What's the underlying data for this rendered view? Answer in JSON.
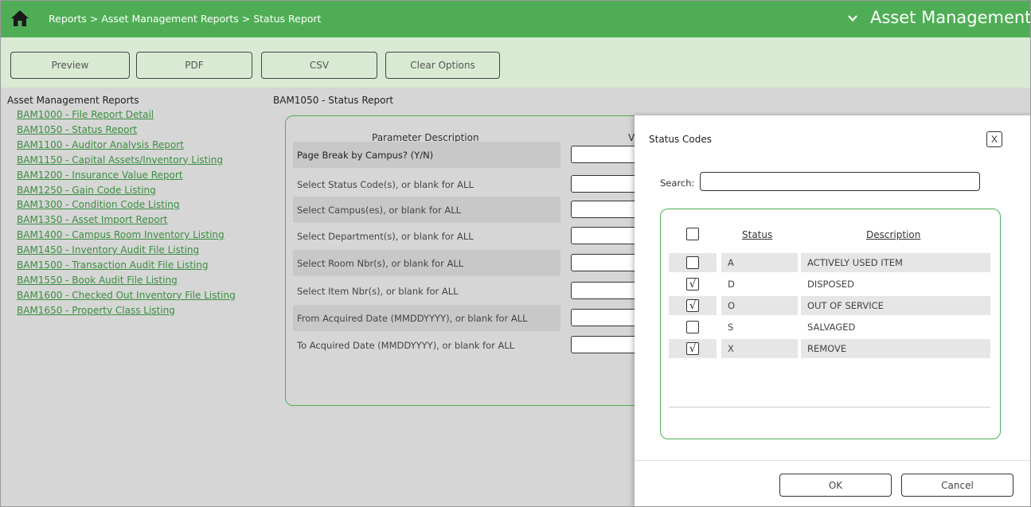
{
  "header": {
    "breadcrumb": "Reports > Asset Management Reports > Status Report",
    "module": "Asset Management"
  },
  "toolbar": {
    "preview": "Preview",
    "pdf": "PDF",
    "csv": "CSV",
    "clear": "Clear Options"
  },
  "nav": {
    "heading": "Asset Management Reports",
    "items": [
      "BAM1000 - File Report Detail",
      "BAM1050 - Status Report",
      "BAM1100 - Auditor Analysis Report",
      "BAM1150 - Capital Assets/Inventory Listing",
      "BAM1200 - Insurance Value Report",
      "BAM1250 - Gain Code Listing",
      "BAM1300 - Condition Code Listing",
      "BAM1350 - Asset Import Report",
      "BAM1400 - Campus Room Inventory Listing",
      "BAM1450 - Inventory Audit File Listing",
      "BAM1500 - Transaction Audit File Listing",
      "BAM1550 - Book Audit File Listing",
      "BAM1600 - Checked Out Inventory File Listing",
      "BAM1650 - Property Class Listing"
    ]
  },
  "main": {
    "heading": "BAM1050 - Status Report",
    "col_param": "Parameter Description",
    "col_value": "V",
    "params": [
      "Page Break by Campus? (Y/N)",
      "Select Status Code(s), or blank for ALL",
      "Select Campus(es), or blank for ALL",
      "Select Department(s), or blank for ALL",
      "Select Room Nbr(s), or blank for ALL",
      "Select Item Nbr(s), or blank for ALL",
      "From Acquired Date (MMDDYYYY), or blank for ALL",
      "To Acquired Date (MMDDYYYY), or blank for ALL"
    ]
  },
  "dialog": {
    "title": "Status Codes",
    "close": "X",
    "search_label": "Search:",
    "search_value": "",
    "col_status": "Status",
    "col_description": "Description",
    "rows": [
      {
        "code": "A",
        "description": "ACTIVELY USED ITEM",
        "checked": false
      },
      {
        "code": "D",
        "description": "DISPOSED",
        "checked": true
      },
      {
        "code": "O",
        "description": "OUT OF SERVICE",
        "checked": true
      },
      {
        "code": "S",
        "description": "SALVAGED",
        "checked": false
      },
      {
        "code": "X",
        "description": "REMOVE",
        "checked": true
      }
    ],
    "ok": "OK",
    "cancel": "Cancel"
  },
  "colors": {
    "accent": "#4fae55",
    "toolbar_bg": "#d9ead3",
    "link": "#3a8f3f"
  },
  "icons": {
    "home": "home-icon",
    "chevron": "chevron-down-icon",
    "check": "checkmark-icon"
  }
}
